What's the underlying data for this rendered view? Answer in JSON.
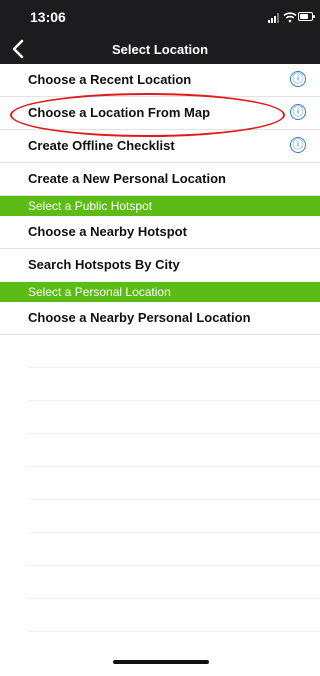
{
  "status": {
    "time": "13:06",
    "battery_level": 0.7
  },
  "nav": {
    "title": "Select Location",
    "back_icon": "chevron-left-icon"
  },
  "rows_top": [
    {
      "label": "Choose a Recent Location",
      "info": "ⓘ"
    },
    {
      "label": "Choose a Location From Map",
      "info": "ⓘ"
    },
    {
      "label": "Create Offline Checklist",
      "info": "ⓘ"
    },
    {
      "label": "Create a New Personal Location"
    }
  ],
  "sections": {
    "public": "Select a Public Hotspot",
    "personal": "Select a Personal Location"
  },
  "rows_public": [
    {
      "label": "Choose a Nearby Hotspot"
    },
    {
      "label": "Search Hotspots By City"
    }
  ],
  "rows_personal": [
    {
      "label": "Choose a Nearby Personal Location"
    }
  ],
  "colors": {
    "bar": "#1c1c1e",
    "section": "#5cbc16",
    "info": "#2a7de1",
    "highlight": "#e01b1b"
  }
}
